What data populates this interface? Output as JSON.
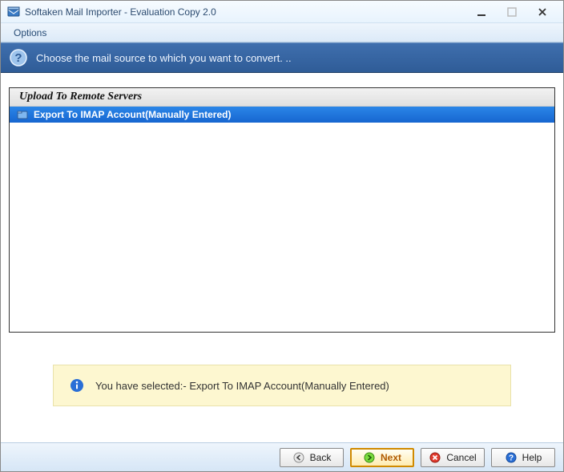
{
  "window": {
    "title": "Softaken Mail Importer - Evaluation Copy 2.0"
  },
  "menubar": {
    "options": "Options"
  },
  "banner": {
    "text": "Choose the mail source to which you want to convert. .."
  },
  "list": {
    "group_header": "Upload To Remote Servers",
    "items": [
      {
        "label": "Export To IMAP Account(Manually Entered)",
        "selected": true
      }
    ]
  },
  "status": {
    "text": "You have selected:- Export To IMAP Account(Manually Entered)"
  },
  "footer": {
    "back": "Back",
    "next": "Next",
    "cancel": "Cancel",
    "help": "Help"
  },
  "colors": {
    "accent_blue": "#2f5c97",
    "selection_blue": "#1766d0",
    "info_yellow": "#fdf7d0"
  }
}
